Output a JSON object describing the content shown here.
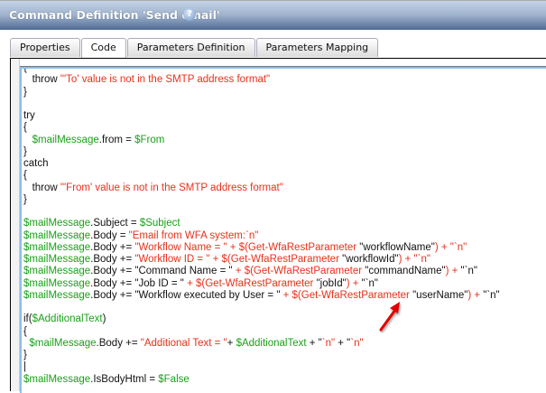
{
  "window": {
    "title": "Command Definition 'Send email'",
    "help_icon": "?"
  },
  "tabs": [
    {
      "label": "Properties"
    },
    {
      "label": "Code",
      "active": true
    },
    {
      "label": "Parameters Definition"
    },
    {
      "label": "Parameters Mapping"
    }
  ],
  "colors": {
    "green": "#1aa01a",
    "red": "#e8301c",
    "arrow": "#e00000"
  },
  "code": {
    "lines": [
      [
        [
          "k",
          "{"
        ]
      ],
      [
        [
          "k",
          "   throw "
        ],
        [
          "r",
          "\"'To' value is not in the SMTP address format\""
        ]
      ],
      [
        [
          "k",
          "}"
        ]
      ],
      [
        [
          "k",
          ""
        ]
      ],
      [
        [
          "k",
          "try"
        ]
      ],
      [
        [
          "k",
          "{"
        ]
      ],
      [
        [
          "k",
          "   "
        ],
        [
          "g",
          "$mailMessage"
        ],
        [
          "k",
          ".from = "
        ],
        [
          "g",
          "$From"
        ]
      ],
      [
        [
          "k",
          "}"
        ]
      ],
      [
        [
          "k",
          "catch"
        ]
      ],
      [
        [
          "k",
          "{"
        ]
      ],
      [
        [
          "k",
          "   throw "
        ],
        [
          "r",
          "\"'From' value is not in the SMTP address format\""
        ]
      ],
      [
        [
          "k",
          "}"
        ]
      ],
      [
        [
          "k",
          ""
        ]
      ],
      [
        [
          "g",
          "$mailMessage"
        ],
        [
          "k",
          ".Subject = "
        ],
        [
          "g",
          "$Subject"
        ]
      ],
      [
        [
          "g",
          "$mailMessage"
        ],
        [
          "k",
          ".Body = "
        ],
        [
          "r",
          "\"Email from WFA system:`n\""
        ]
      ],
      [
        [
          "g",
          "$mailMessage"
        ],
        [
          "k",
          ".Body += "
        ],
        [
          "r",
          "\"Workflow Name = \" + $(Get-WfaRestParameter "
        ],
        [
          "k",
          "\"workflowName\""
        ],
        [
          "r",
          ") + \"`n\""
        ]
      ],
      [
        [
          "g",
          "$mailMessage"
        ],
        [
          "k",
          ".Body += "
        ],
        [
          "r",
          "\"Workflow ID = \" + $(Get-WfaRestParameter "
        ],
        [
          "k",
          "\"workflowId\""
        ],
        [
          "r",
          ") + \"`n\""
        ]
      ],
      [
        [
          "g",
          "$mailMessage"
        ],
        [
          "k",
          ".Body += \"Command Name = \" "
        ],
        [
          "r",
          "+ $(Get-WfaRestParameter "
        ],
        [
          "k",
          "\"commandName\""
        ],
        [
          "r",
          ") + "
        ],
        [
          "k",
          "\"`n\""
        ]
      ],
      [
        [
          "g",
          "$mailMessage"
        ],
        [
          "k",
          ".Body += \"Job ID = \" "
        ],
        [
          "r",
          "+ $(Get-WfaRestParameter "
        ],
        [
          "k",
          "\"jobId\""
        ],
        [
          "r",
          ") + "
        ],
        [
          "k",
          "\"`n\""
        ]
      ],
      [
        [
          "g",
          "$mailMessage"
        ],
        [
          "k",
          ".Body += \"Workflow executed by User = \" "
        ],
        [
          "r",
          "+ $(Get-WfaRestParameter "
        ],
        [
          "k",
          "\"userName\""
        ],
        [
          "r",
          ") + "
        ],
        [
          "k",
          "\"`n\""
        ]
      ],
      [
        [
          "k",
          ""
        ]
      ],
      [
        [
          "k",
          "if("
        ],
        [
          "g",
          "$AdditionalText"
        ],
        [
          "k",
          ")"
        ]
      ],
      [
        [
          "k",
          "{"
        ]
      ],
      [
        [
          "k",
          "  "
        ],
        [
          "g",
          "$mailMessage"
        ],
        [
          "k",
          ".Body += "
        ],
        [
          "r",
          "\"Additional Text = \""
        ],
        [
          "k",
          "+ "
        ],
        [
          "g",
          "$AdditionalText"
        ],
        [
          "k",
          " + \""
        ],
        [
          "r",
          "`n\""
        ],
        [
          "k",
          " + \""
        ],
        [
          "r",
          "`n\""
        ]
      ],
      [
        [
          "k",
          "}"
        ]
      ],
      [
        [
          "k",
          "|"
        ]
      ],
      [
        [
          "g",
          "$mailMessage"
        ],
        [
          "k",
          ".IsBodyHtml = "
        ],
        [
          "g",
          "$False"
        ]
      ]
    ]
  }
}
